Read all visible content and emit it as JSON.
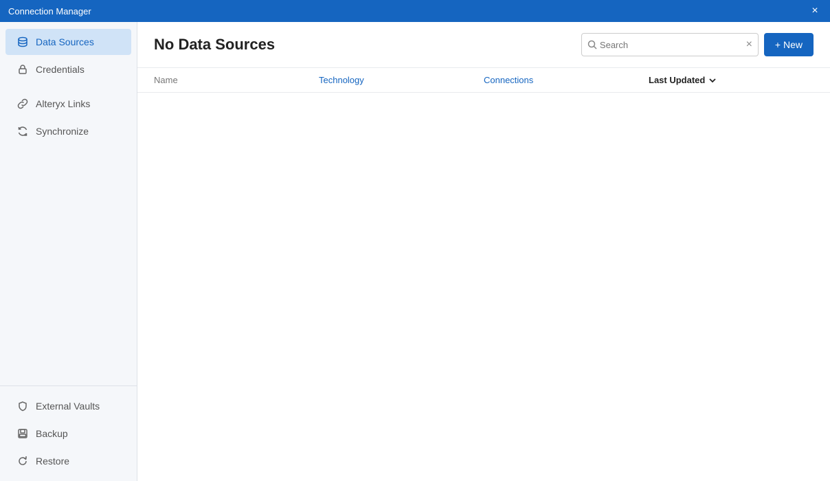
{
  "titleBar": {
    "title": "Connection Manager",
    "closeLabel": "×"
  },
  "sidebar": {
    "topItems": [
      {
        "id": "data-sources",
        "label": "Data Sources",
        "active": true,
        "icon": "database"
      },
      {
        "id": "credentials",
        "label": "Credentials",
        "active": false,
        "icon": "lock"
      }
    ],
    "midItems": [
      {
        "id": "alteryx-links",
        "label": "Alteryx Links",
        "active": false,
        "icon": "link"
      },
      {
        "id": "synchronize",
        "label": "Synchronize",
        "active": false,
        "icon": "sync"
      }
    ],
    "bottomItems": [
      {
        "id": "external-vaults",
        "label": "External Vaults",
        "active": false,
        "icon": "shield"
      },
      {
        "id": "backup",
        "label": "Backup",
        "active": false,
        "icon": "save"
      },
      {
        "id": "restore",
        "label": "Restore",
        "active": false,
        "icon": "restore"
      }
    ]
  },
  "main": {
    "title": "No Data Sources",
    "search": {
      "placeholder": "Search",
      "value": ""
    },
    "newButton": "+ New",
    "table": {
      "columns": [
        {
          "id": "name",
          "label": "Name",
          "color": "muted",
          "sortable": false
        },
        {
          "id": "technology",
          "label": "Technology",
          "color": "blue",
          "sortable": false
        },
        {
          "id": "connections",
          "label": "Connections",
          "color": "blue",
          "sortable": false
        },
        {
          "id": "lastUpdated",
          "label": "Last Updated",
          "color": "dark",
          "sortable": true,
          "sorted": "desc"
        }
      ],
      "rows": []
    }
  }
}
